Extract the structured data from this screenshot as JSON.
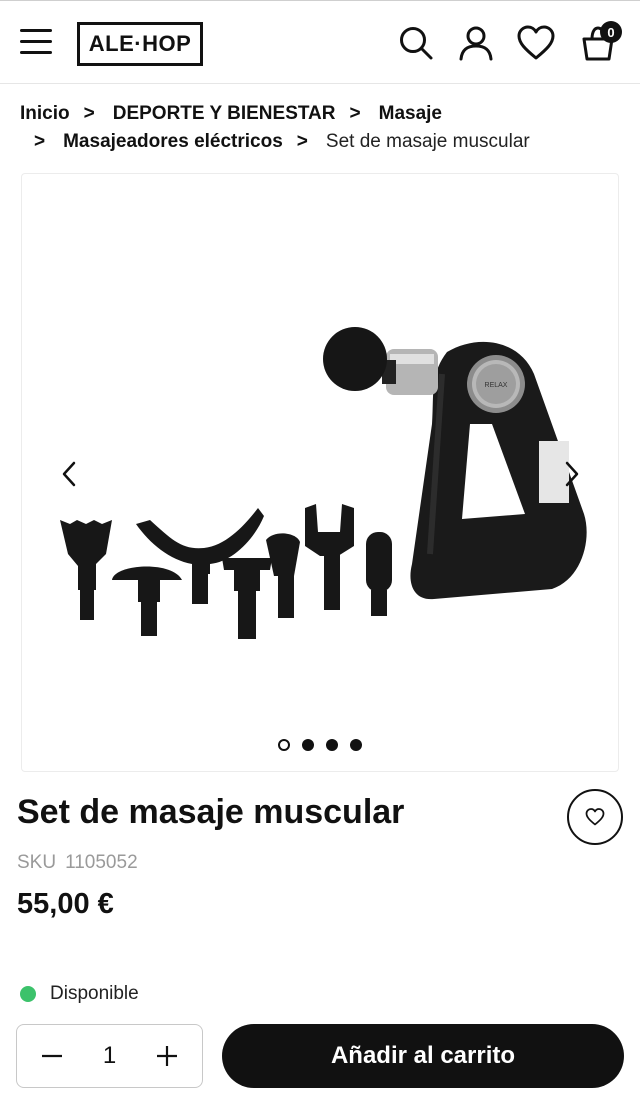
{
  "header": {
    "logo_text": "ALE·HOP",
    "cart_count": "0"
  },
  "breadcrumb": {
    "separator": ">",
    "items": [
      "Inicio",
      "DEPORTE Y BIENESTAR",
      "Masaje",
      "Masajeadores eléctricos"
    ],
    "current": "Set de masaje muscular"
  },
  "gallery": {
    "device_brand": "RELAX",
    "slide_count": 4,
    "active_slide": 1
  },
  "product": {
    "title": "Set de masaje muscular",
    "sku_label": "SKU",
    "sku_value": "1105052",
    "price": "55,00 €",
    "availability": "Disponible",
    "availability_color": "#3cc26b"
  },
  "purchase": {
    "quantity": "1",
    "add_to_cart_label": "Añadir al carrito"
  },
  "colors": {
    "primary": "#111111",
    "background": "#ffffff"
  }
}
